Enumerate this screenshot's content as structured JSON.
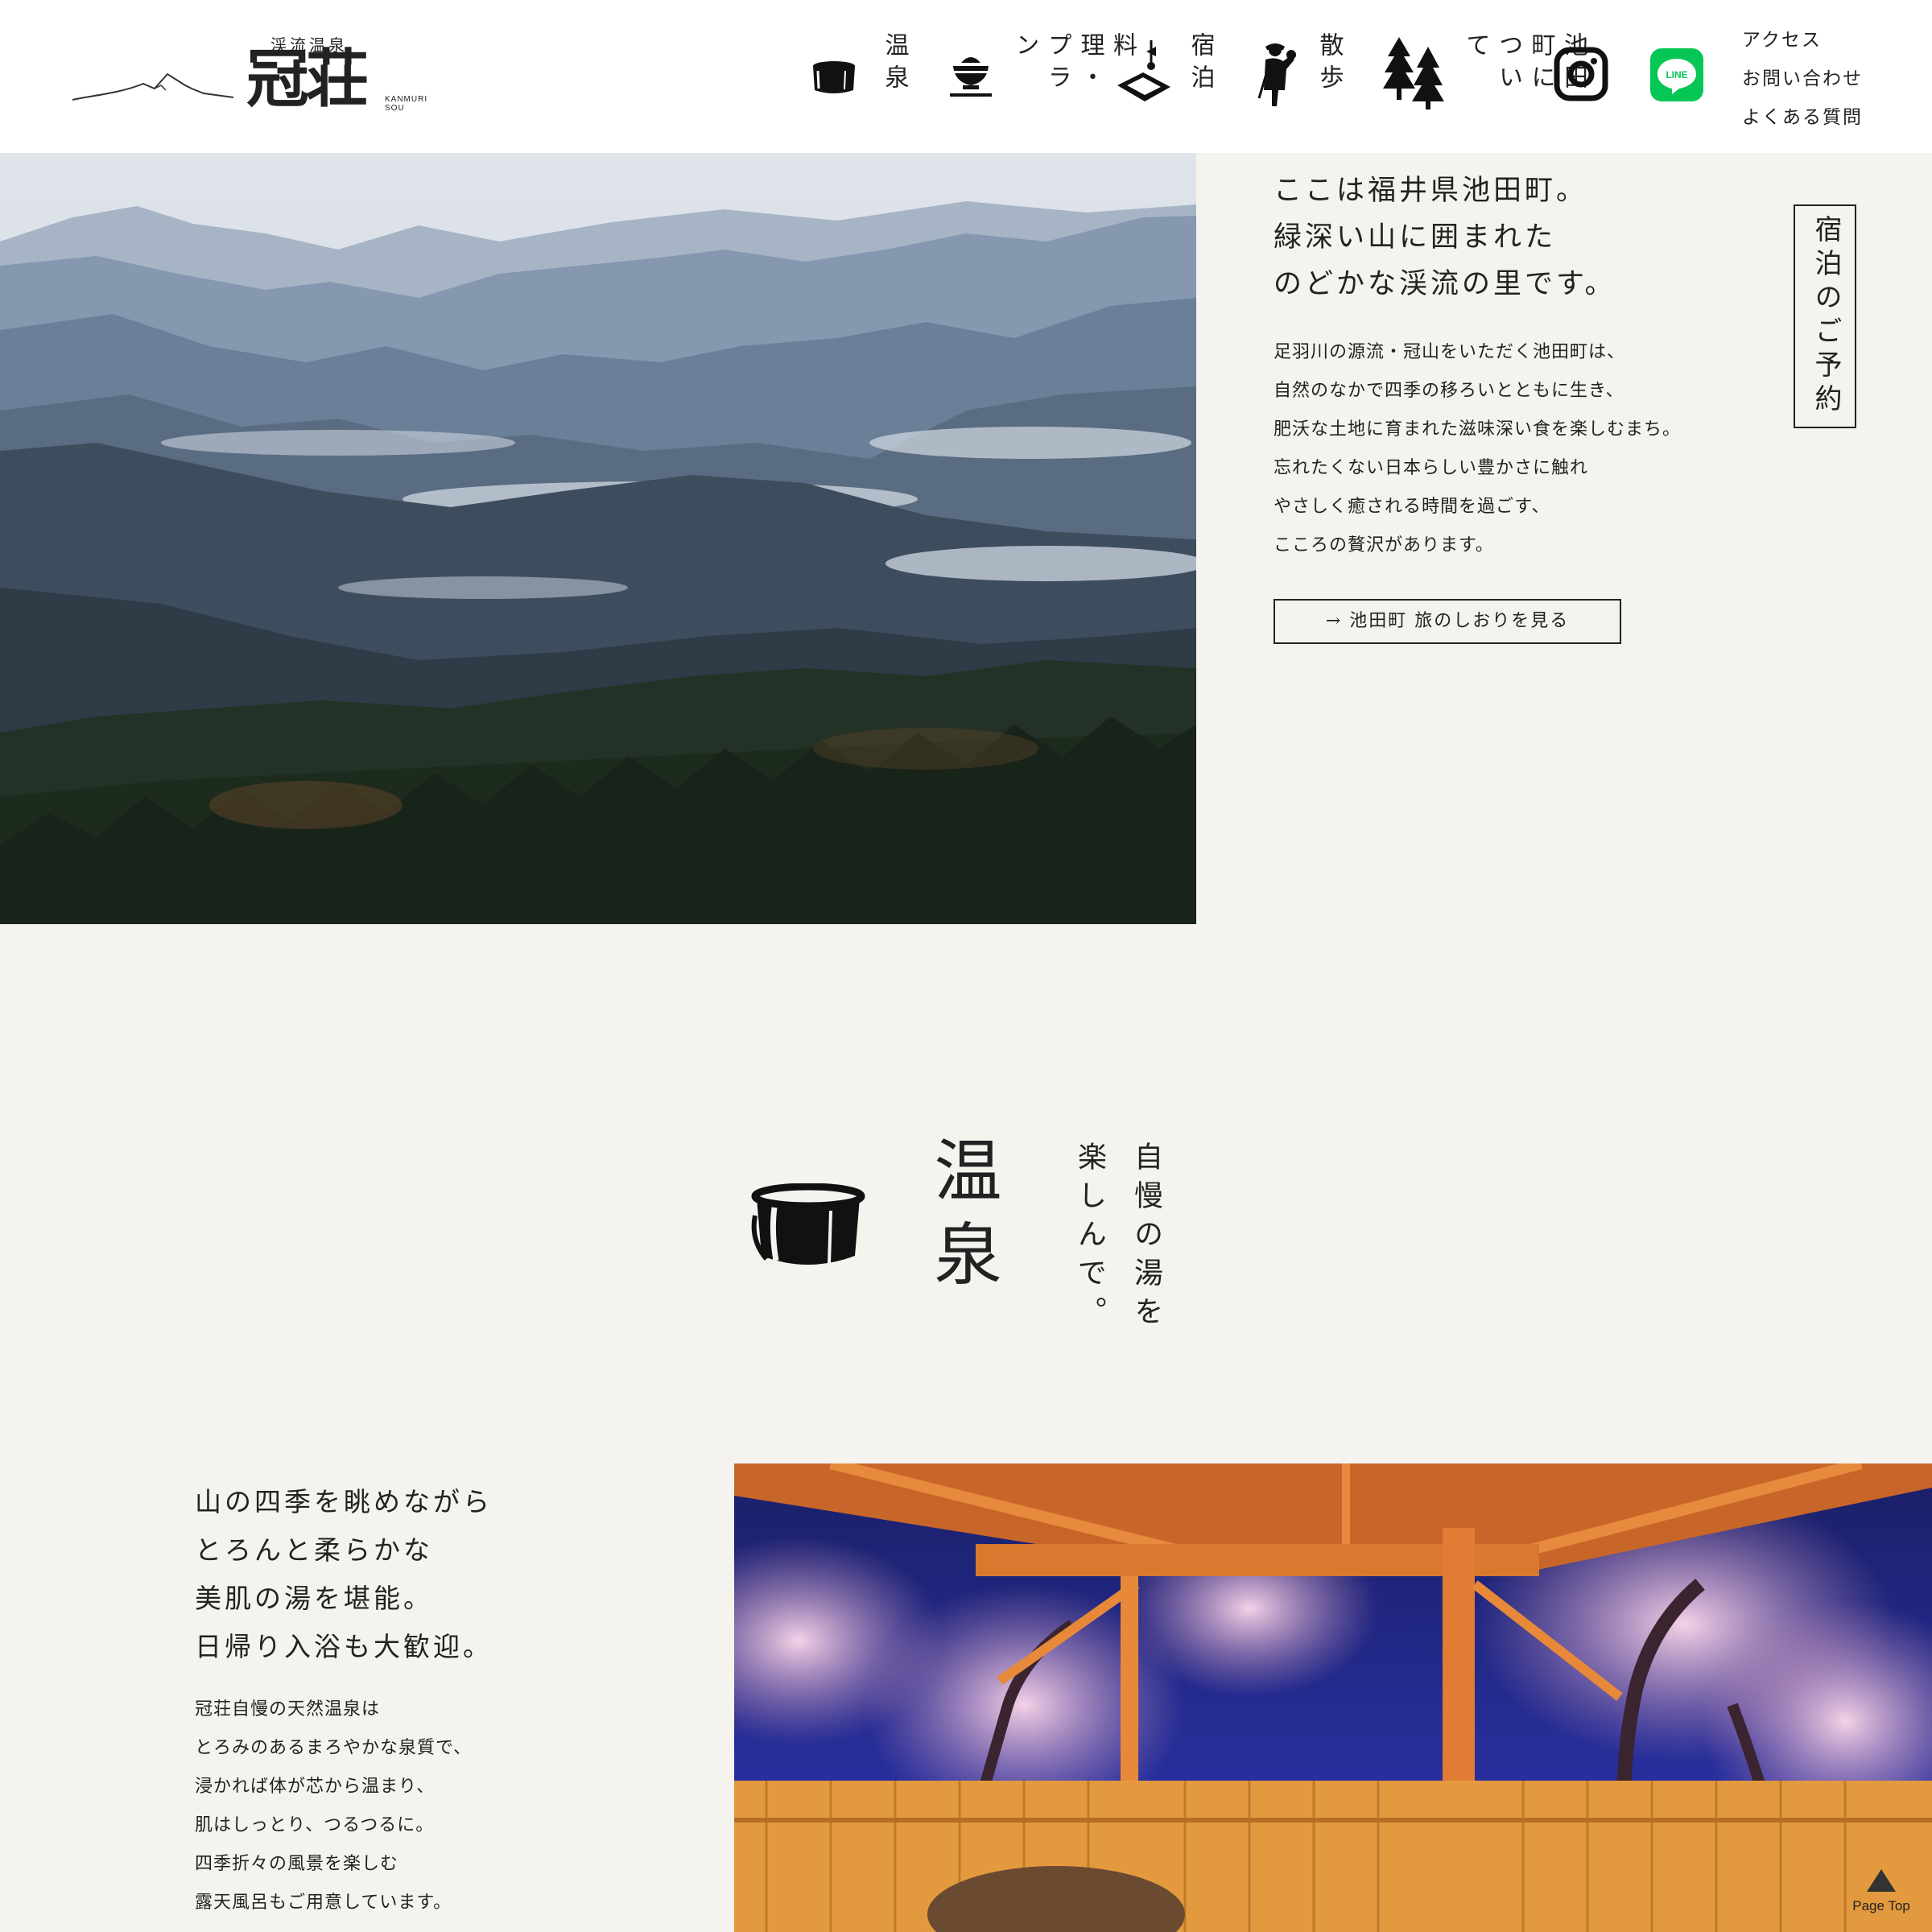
{
  "header": {
    "logo_small": "渓流温泉",
    "logo_big": "冠荘",
    "logo_en": "KANMURI SOU",
    "nav": [
      {
        "label": "温泉",
        "icon": "bucket-icon"
      },
      {
        "label": "料理・プラン",
        "icon": "rice-bowl-icon"
      },
      {
        "label": "宿泊",
        "icon": "futon-lamp-icon"
      },
      {
        "label": "散歩",
        "icon": "walker-icon"
      },
      {
        "label": "池田町について",
        "icon": "trees-icon"
      }
    ],
    "instagram_icon": "instagram-icon",
    "line_icon": "line-icon",
    "line_text": "LINE",
    "util_links": [
      "アクセス",
      "お問い合わせ",
      "よくある質問"
    ]
  },
  "hero": {
    "title_lines": [
      "ここは福井県池田町。",
      "緑深い山に囲まれた",
      "のどかな渓流の里です。"
    ],
    "body_lines": [
      "足羽川の源流・冠山をいただく池田町は、",
      "自然のなかで四季の移ろいとともに生き、",
      "肥沃な土地に育まれた滋味深い食を楽しむまち。",
      "忘れたくない日本らしい豊かさに触れ",
      "やさしく癒される時間を過ごす、",
      "こころの贅沢があります。"
    ],
    "button_label": "→ 池田町 旅のしおりを見る",
    "reserve_label": "宿泊のご予約"
  },
  "onsen": {
    "heading": "温泉",
    "sub_lines": [
      "自慢の湯を",
      "楽しんで。"
    ],
    "title_lines": [
      "山の四季を眺めながら",
      "とろんと柔らかな",
      "美肌の湯を堪能。",
      "日帰り入浴も大歓迎。"
    ],
    "body_lines": [
      "冠荘自慢の天然温泉は",
      "とろみのあるまろやかな泉質で、",
      "浸かれば体が芯から温まり、",
      "肌はしっとり、つるつるに。",
      "四季折々の風景を楽しむ",
      "露天風呂もご用意しています。"
    ]
  },
  "page_top": "Page Top",
  "colors": {
    "background": "#f5f3ee",
    "header": "#ffffff",
    "text": "#222222",
    "line_green": "#06c755"
  }
}
